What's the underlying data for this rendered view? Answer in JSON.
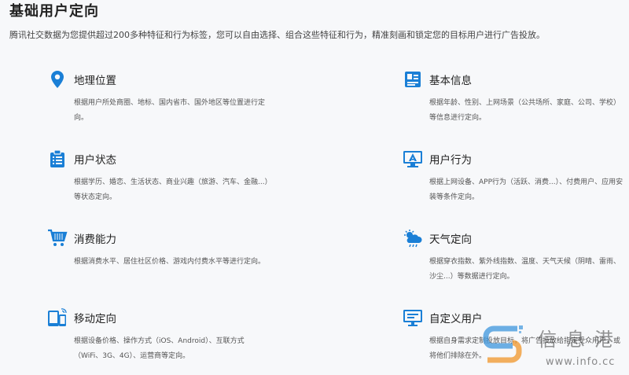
{
  "page": {
    "title": "基础用户定向",
    "description": "腾讯社交数据为您提供超过200多种特征和行为标签，您可以自由选择、组合这些特征和行为，精准刻画和锁定您的目标用户进行广告投放。"
  },
  "features": [
    {
      "icon": "location-pin-icon",
      "name": "地理位置",
      "text": "根据用户所处商圈、地标、国内省市、国外地区等位置进行定向。"
    },
    {
      "icon": "id-card-icon",
      "name": "基本信息",
      "text": "根据年龄、性别、上网场景（公共场所、家庭、公司、学校）等信息进行定向。"
    },
    {
      "icon": "clipboard-icon",
      "name": "用户状态",
      "text": "根据学历、婚恋、生活状态、商业兴趣（旅游、汽车、金融...）等状态定向。"
    },
    {
      "icon": "monitor-app-icon",
      "name": "用户行为",
      "text": "根据上网设备、APP行为（活跃、消费...）、付费用户、应用安装等条件定向。"
    },
    {
      "icon": "shopping-cart-icon",
      "name": "消费能力",
      "text": "根据消费水平、居住社区价格、游戏内付费水平等进行定向。"
    },
    {
      "icon": "weather-cloud-icon",
      "name": "天气定向",
      "text": "根据穿衣指数、紫外线指数、温度、天气天候（阴晴、雷雨、沙尘...）等数据进行定向。"
    },
    {
      "icon": "mobile-devices-icon",
      "name": "移动定向",
      "text": "根据设备价格、操作方式（iOS、Android）、互联方式（WiFi、3G、4G）、运营商等定向。"
    },
    {
      "icon": "desktop-icon",
      "name": "自定义用户",
      "text": "根据自身需求定制投放目标，将广告投放给指定受众用户，或将他们排除在外。"
    }
  ],
  "watermark": {
    "text": "信息港",
    "url": "www.info.cc"
  },
  "colors": {
    "accent": "#1a7fd6",
    "background": "#f7f8fa"
  }
}
